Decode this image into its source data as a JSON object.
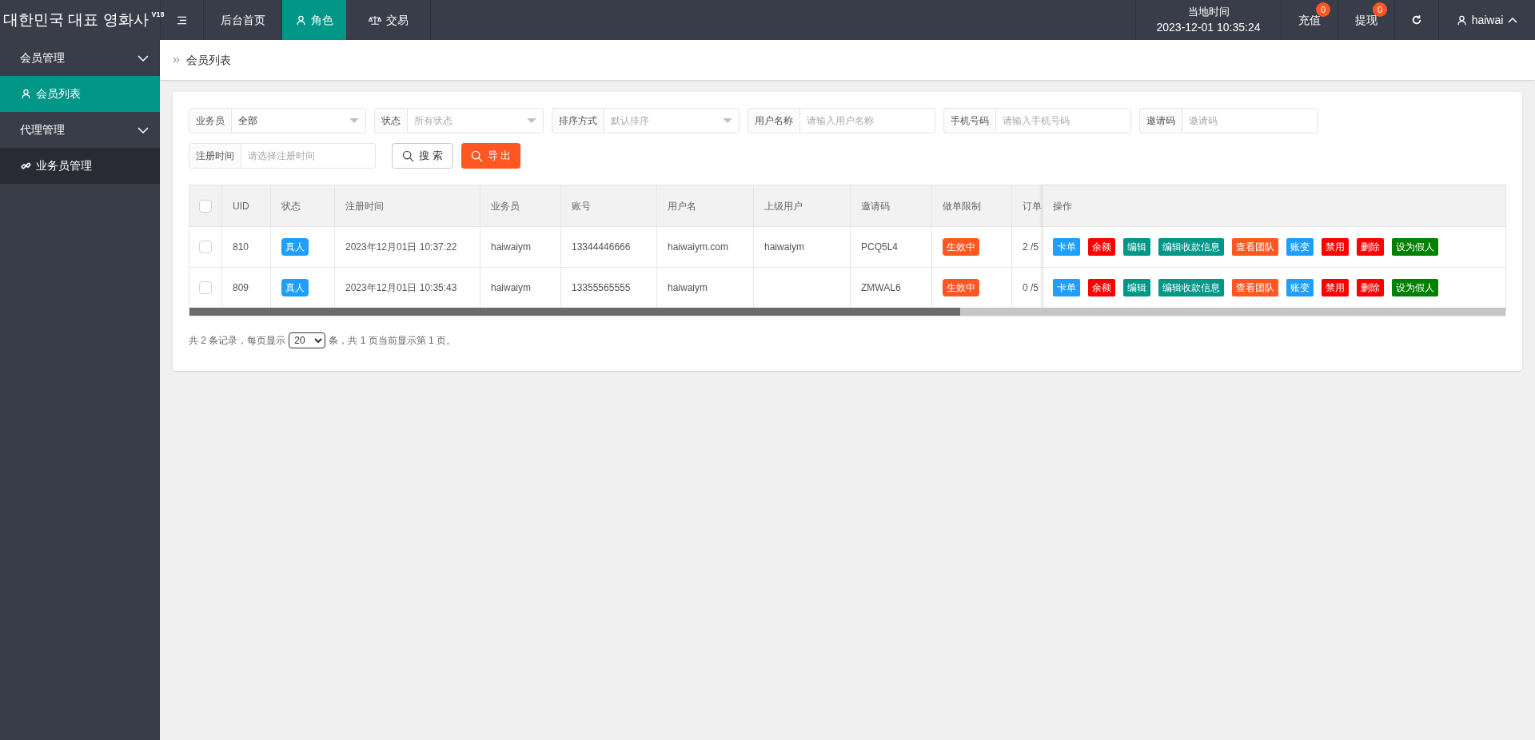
{
  "brand": {
    "title": "대한민국 대표 영화사",
    "version": "V18"
  },
  "top_nav": [
    {
      "label": "后台首页",
      "selected": false
    },
    {
      "label": "角色",
      "selected": true
    },
    {
      "label": "交易",
      "selected": false
    }
  ],
  "clock": {
    "label": "当地时间",
    "time": "2023-12-01 10:35:24"
  },
  "top_actions": [
    {
      "label": "充值",
      "badge": "0"
    },
    {
      "label": "提现",
      "badge": "0"
    }
  ],
  "user": {
    "name": "haiwai"
  },
  "sidebar": {
    "items": [
      {
        "label": "会员管理",
        "expanded": true,
        "children": [
          {
            "label": "会员列表",
            "selected": true
          }
        ]
      },
      {
        "label": "代理管理",
        "expanded": true,
        "children": [
          {
            "label": "业务员管理",
            "selected": false
          }
        ]
      }
    ]
  },
  "breadcrumb": "会员列表",
  "filters": [
    {
      "kind": "select",
      "label": "业务员",
      "value": "全部"
    },
    {
      "kind": "select",
      "label": "状态",
      "placeholder": "所有状态"
    },
    {
      "kind": "select",
      "label": "排序方式",
      "placeholder": "默认排序"
    },
    {
      "kind": "input",
      "label": "用户名称",
      "placeholder": "请输入用户名称"
    },
    {
      "kind": "input",
      "label": "手机号码",
      "placeholder": "请输入手机号码"
    },
    {
      "kind": "input",
      "label": "邀请码",
      "placeholder": "邀请码"
    },
    {
      "kind": "input",
      "label": "注册时间",
      "placeholder": "请选择注册时间"
    }
  ],
  "buttons": [
    {
      "kind": "outline",
      "label": "搜 索"
    },
    {
      "kind": "primary",
      "label": "导 出"
    }
  ],
  "table": {
    "all_checked": false,
    "columns": [
      "UID",
      "状态",
      "注册时间",
      "业务员",
      "账号",
      "用户名",
      "上级用户",
      "邀请码",
      "做单限制",
      "订单",
      "操作"
    ],
    "rows": [
      {
        "checked": false,
        "cells": [
          "810",
          "真人",
          "2023年12月01日 10:37:22",
          "haiwaiym",
          "13344446666",
          "haiwaiym.com",
          "haiwaiym",
          "PCQ5L4",
          "生效中",
          "2 /5"
        ],
        "actions": [
          {
            "label": "卡单",
            "color": "#1e9fff"
          },
          {
            "label": "余额",
            "color": "#ff0000"
          },
          {
            "label": "编辑",
            "color": "#009688"
          },
          {
            "label": "编辑收款信息",
            "color": "#009688"
          },
          {
            "label": "查看团队",
            "color": "#ff5722"
          },
          {
            "label": "账变",
            "color": "#1e9fff"
          },
          {
            "label": "禁用",
            "color": "#ff0000"
          },
          {
            "label": "删除",
            "color": "#ff0000"
          },
          {
            "label": "设为假人",
            "color": "#008000"
          }
        ]
      },
      {
        "checked": false,
        "cells": [
          "809",
          "真人",
          "2023年12月01日 10:35:43",
          "haiwaiym",
          "13355565555",
          "haiwaiym",
          "",
          "ZMWAL6",
          "生效中",
          "0 /5"
        ],
        "actions": [
          {
            "label": "卡单",
            "color": "#1e9fff"
          },
          {
            "label": "余额",
            "color": "#ff0000"
          },
          {
            "label": "编辑",
            "color": "#009688"
          },
          {
            "label": "编辑收款信息",
            "color": "#009688"
          },
          {
            "label": "查看团队",
            "color": "#ff5722"
          },
          {
            "label": "账变",
            "color": "#1e9fff"
          },
          {
            "label": "禁用",
            "color": "#ff0000"
          },
          {
            "label": "删除",
            "color": "#ff0000"
          },
          {
            "label": "设为假人",
            "color": "#008000"
          }
        ]
      }
    ]
  },
  "pagination": {
    "before": "共 2 条记录，每页显示",
    "page_size": "20",
    "after": "条，共 1 页当前显示第 1 页。"
  }
}
